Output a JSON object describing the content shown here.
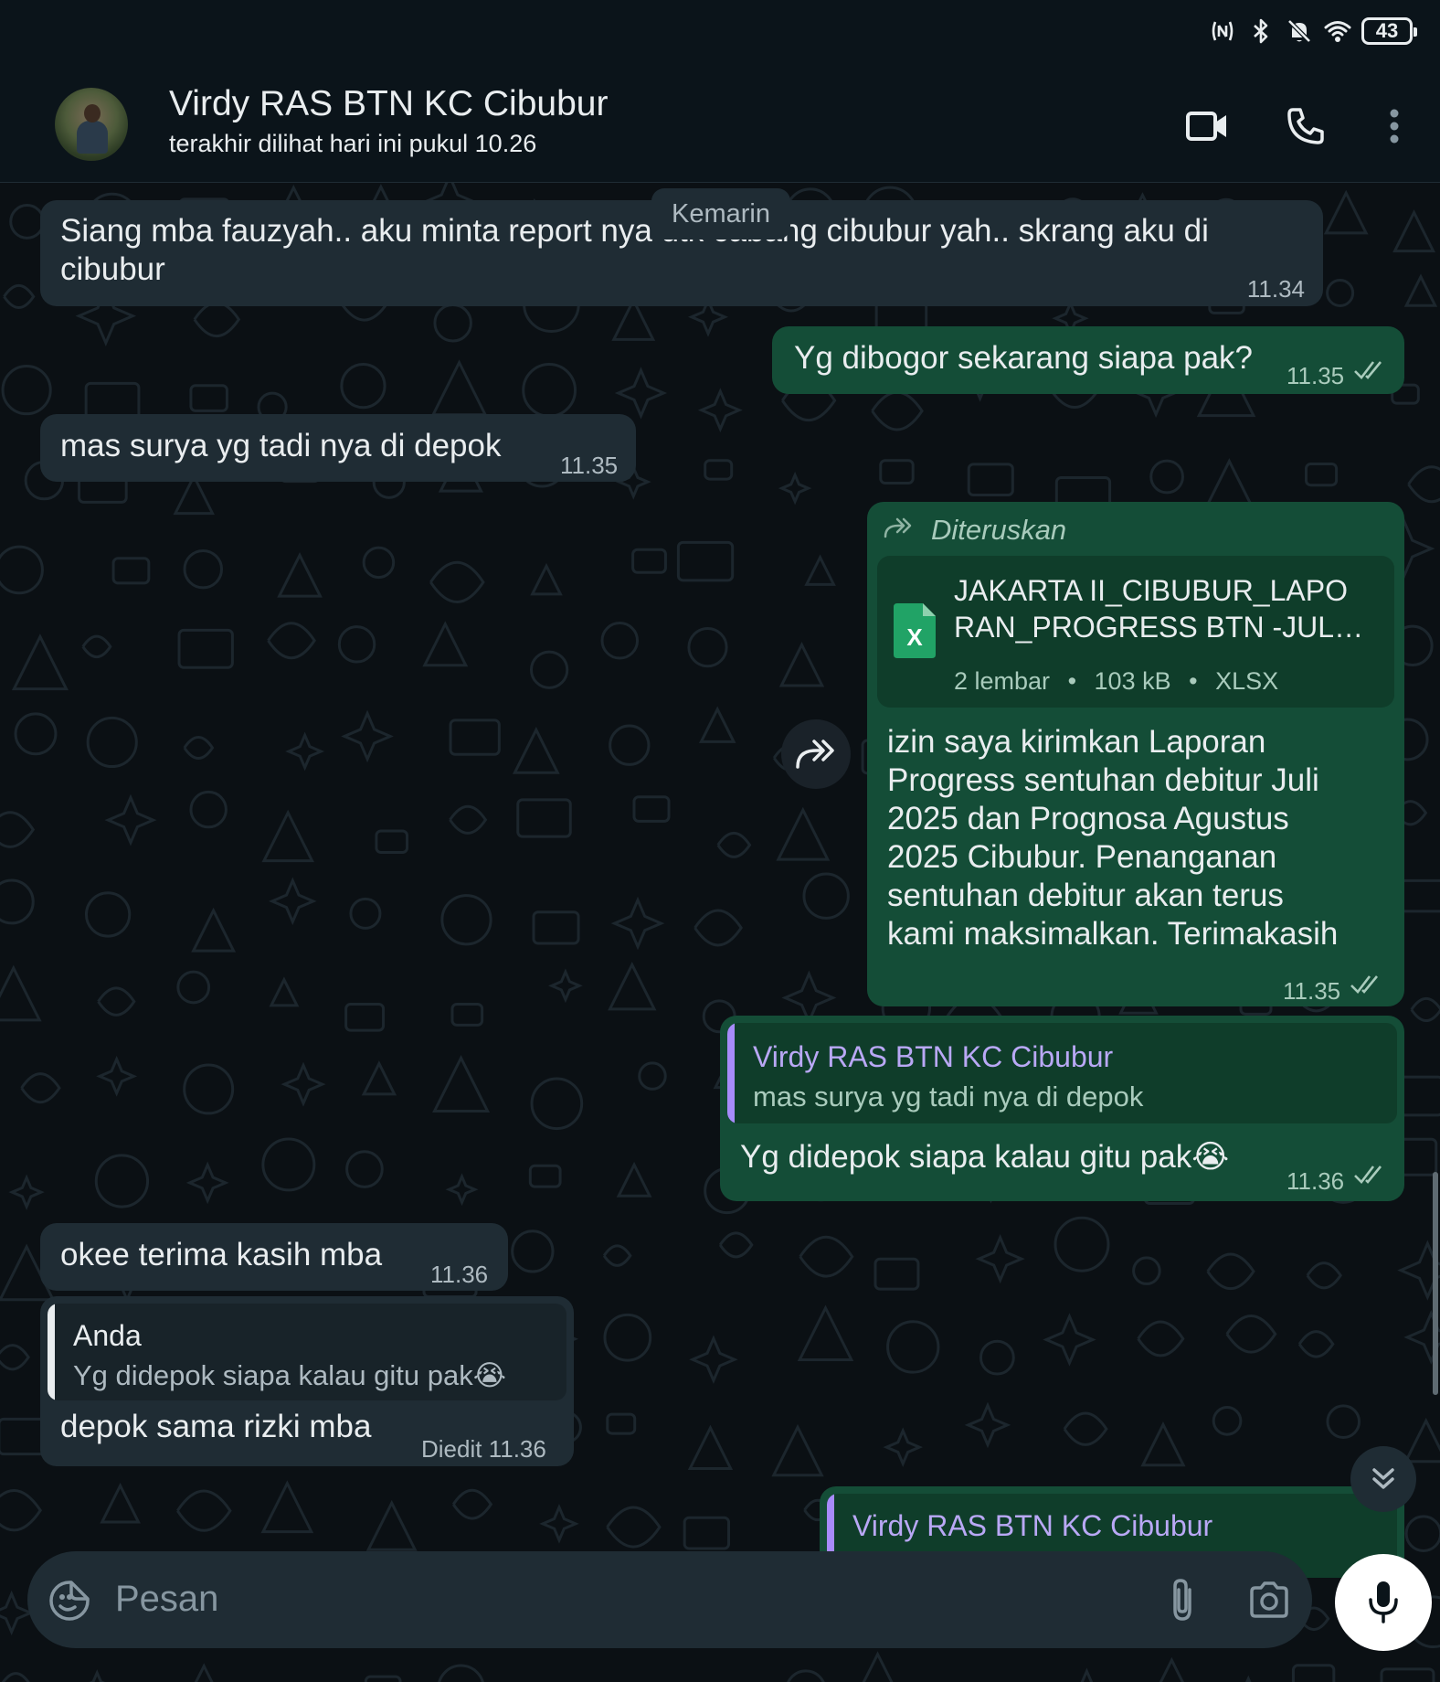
{
  "status_bar": {
    "battery": "43",
    "icons": [
      "nfc-icon",
      "bluetooth-icon",
      "mute-bell-icon",
      "wifi-icon",
      "battery-icon"
    ]
  },
  "header": {
    "name": "Virdy RAS BTN KC Cibubur",
    "status": "terakhir dilihat hari ini pukul 10.26"
  },
  "date_chip": "Kemarin",
  "messages": [
    {
      "line1": "Siang mba fauzyah.. aku minta report nya utk cabang cibubur yah.. skrang aku di",
      "line2": "cibubur",
      "time": "11.34"
    },
    {
      "text": "Yg dibogor sekarang siapa pak?",
      "time": "11.35"
    },
    {
      "text": "mas surya yg tadi nya di depok",
      "time": "11.35"
    },
    {
      "forwarded_label": "Diteruskan",
      "doc": {
        "name_line1": "JAKARTA II_CIBUBUR_LAPO",
        "name_line2": "RAN_PROGRESS BTN -JUL…",
        "pages": "2 lembar",
        "size": "103 kB",
        "type": "XLSX",
        "icon_letter": "X"
      },
      "lines": [
        "izin saya kirimkan Laporan",
        "Progress sentuhan debitur Juli",
        "2025 dan Prognosa Agustus",
        "2025 Cibubur. Penanganan",
        "sentuhan debitur akan terus",
        "kami maksimalkan. Terimakasih"
      ],
      "time": "11.35"
    },
    {
      "quote_author": "Virdy RAS BTN KC Cibubur",
      "quote_text": "mas surya yg tadi nya di depok",
      "text": "Yg didepok siapa kalau gitu pak😭",
      "time": "11.36"
    },
    {
      "text": "okee terima kasih mba",
      "time": "11.36"
    },
    {
      "quote_author": "Anda",
      "quote_text": "Yg didepok siapa kalau gitu pak😭",
      "text": "depok sama rizki mba",
      "edited": "Diedit",
      "time": "11.36"
    },
    {
      "quote_author": "Virdy RAS BTN KC Cibubur"
    }
  ],
  "input": {
    "placeholder": "Pesan"
  },
  "colors": {
    "incoming": "#1f2c34",
    "outgoing": "#144d37",
    "accent_purple": "#a78bfa",
    "background": "#0b141a"
  }
}
